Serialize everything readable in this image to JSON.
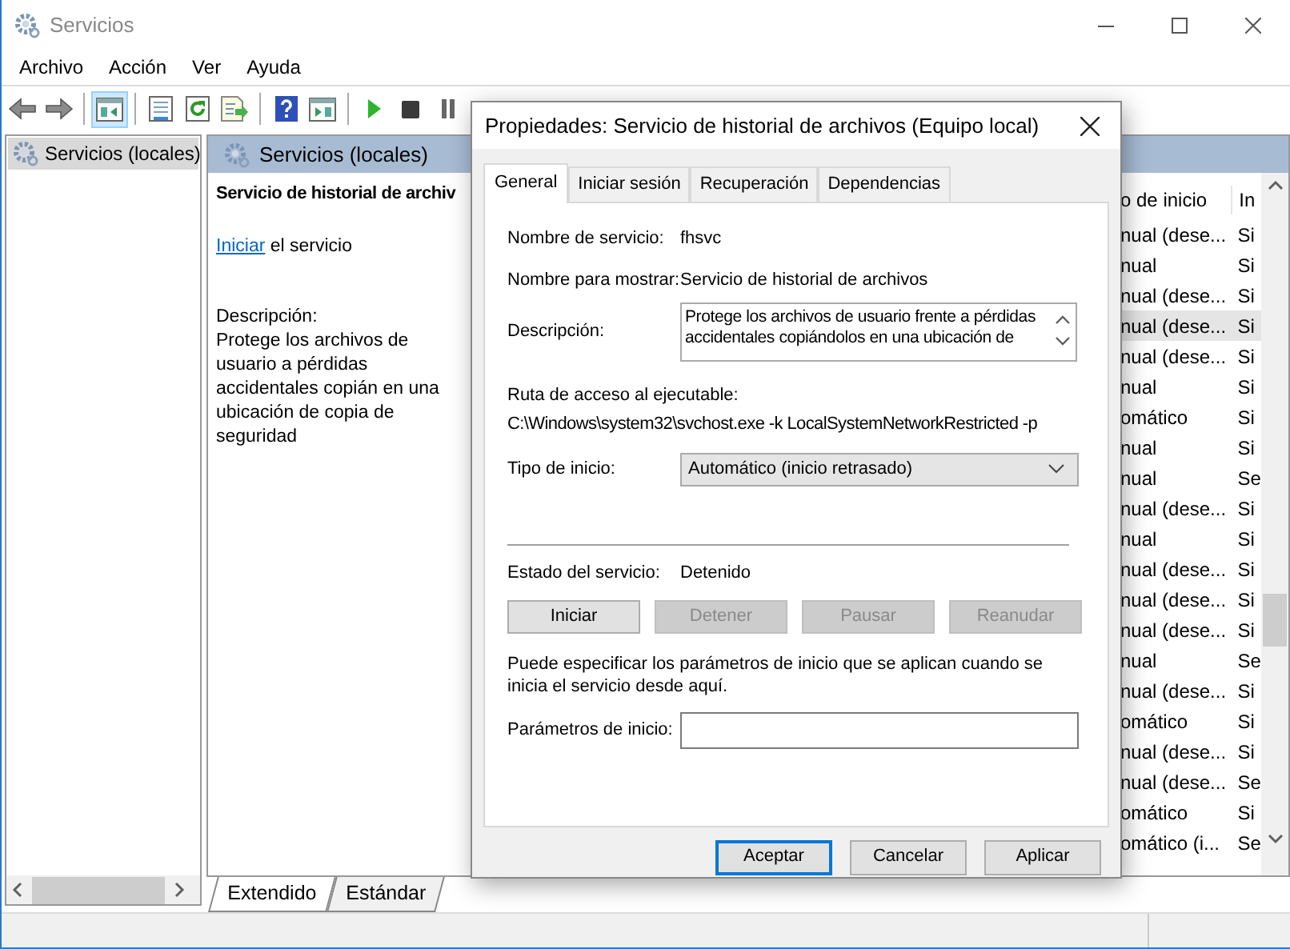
{
  "window": {
    "title": "Servicios"
  },
  "menu": [
    "Archivo",
    "Acción",
    "Ver",
    "Ayuda"
  ],
  "toolbar": [
    {
      "kind": "back",
      "disabled": false,
      "selected": false
    },
    {
      "kind": "forward",
      "disabled": false,
      "selected": false
    },
    {
      "kind": "sep"
    },
    {
      "kind": "tree",
      "disabled": false,
      "selected": true
    },
    {
      "kind": "sep"
    },
    {
      "kind": "properties",
      "disabled": false,
      "selected": false
    },
    {
      "kind": "refresh",
      "disabled": false,
      "selected": false
    },
    {
      "kind": "export",
      "disabled": false,
      "selected": false
    },
    {
      "kind": "sep"
    },
    {
      "kind": "help",
      "disabled": false,
      "selected": false
    },
    {
      "kind": "console",
      "disabled": false,
      "selected": false
    },
    {
      "kind": "sep"
    },
    {
      "kind": "play",
      "disabled": false,
      "selected": false
    },
    {
      "kind": "stop",
      "disabled": false,
      "selected": false
    },
    {
      "kind": "pause",
      "disabled": false,
      "selected": false
    }
  ],
  "tree": {
    "items": [
      {
        "label": "Servicios (locales)",
        "selected": true
      }
    ]
  },
  "panel": {
    "header": "Servicios (locales)",
    "service_title": "Servicio de historial de archiv",
    "action_link": "Iniciar",
    "action_text": "el servicio",
    "description_label": "Descripción:",
    "description": "Protege los archivos de usuario a pérdidas accidentales copián en una ubicación de copia de seguridad"
  },
  "list": {
    "columns": [
      "o de inicio",
      "In"
    ],
    "rows": [
      {
        "cells": [
          "nual (dese...",
          "Si"
        ],
        "highlighted": false
      },
      {
        "cells": [
          "nual",
          "Si"
        ],
        "highlighted": false
      },
      {
        "cells": [
          "nual (dese...",
          "Si"
        ],
        "highlighted": false
      },
      {
        "cells": [
          "nual (dese...",
          "Si"
        ],
        "highlighted": true
      },
      {
        "cells": [
          "nual (dese...",
          "Si"
        ],
        "highlighted": false
      },
      {
        "cells": [
          "nual",
          "Si"
        ],
        "highlighted": false
      },
      {
        "cells": [
          "omático",
          "Si"
        ],
        "highlighted": false
      },
      {
        "cells": [
          "nual",
          "Si"
        ],
        "highlighted": false
      },
      {
        "cells": [
          "nual",
          "Se"
        ],
        "highlighted": false
      },
      {
        "cells": [
          "nual (dese...",
          "Si"
        ],
        "highlighted": false
      },
      {
        "cells": [
          "nual",
          "Si"
        ],
        "highlighted": false
      },
      {
        "cells": [
          "nual (dese...",
          "Si"
        ],
        "highlighted": false
      },
      {
        "cells": [
          "nual (dese...",
          "Si"
        ],
        "highlighted": false
      },
      {
        "cells": [
          "nual (dese...",
          "Si"
        ],
        "highlighted": false
      },
      {
        "cells": [
          "nual",
          "Se"
        ],
        "highlighted": false
      },
      {
        "cells": [
          "nual (dese...",
          "Si"
        ],
        "highlighted": false
      },
      {
        "cells": [
          "omático",
          "Si"
        ],
        "highlighted": false
      },
      {
        "cells": [
          "nual (dese...",
          "Si"
        ],
        "highlighted": false
      },
      {
        "cells": [
          "nual (dese...",
          "Se"
        ],
        "highlighted": false
      },
      {
        "cells": [
          "omático",
          "Si"
        ],
        "highlighted": false
      },
      {
        "cells": [
          "omático (i...",
          "Se"
        ],
        "highlighted": false
      }
    ]
  },
  "view_tabs": [
    {
      "label": "Extendido",
      "selected": true
    },
    {
      "label": "Estándar",
      "selected": false
    }
  ],
  "dialog": {
    "title": "Propiedades: Servicio de historial de archivos (Equipo local)",
    "tabs": [
      {
        "label": "General",
        "selected": true
      },
      {
        "label": "Iniciar sesión",
        "selected": false
      },
      {
        "label": "Recuperación",
        "selected": false
      },
      {
        "label": "Dependencias",
        "selected": false
      }
    ],
    "service_name": {
      "label": "Nombre de servicio:",
      "value": "fhsvc"
    },
    "display_name": {
      "label": "Nombre para mostrar:",
      "value": "Servicio de historial de archivos"
    },
    "description": {
      "label": "Descripción:",
      "lines": [
        "Protege los archivos de usuario frente a pérdidas",
        "accidentales copiándolos en una ubicación de"
      ]
    },
    "path": {
      "label": "Ruta de acceso al ejecutable:",
      "value": "C:\\Windows\\system32\\svchost.exe -k LocalSystemNetworkRestricted -p"
    },
    "startup_type": {
      "label": "Tipo de inicio:",
      "value": "Automático (inicio retrasado)"
    },
    "status": {
      "label": "Estado del servicio:",
      "value": "Detenido"
    },
    "service_buttons": [
      {
        "label": "Iniciar",
        "disabled": false
      },
      {
        "label": "Detener",
        "disabled": true
      },
      {
        "label": "Pausar",
        "disabled": true
      },
      {
        "label": "Reanudar",
        "disabled": true
      }
    ],
    "note": "Puede especificar los parámetros de inicio que se aplican cuando se inicia el servicio desde aquí.",
    "parameters": {
      "label": "Parámetros de inicio:"
    },
    "buttons": [
      {
        "label": "Aceptar",
        "default": true
      },
      {
        "label": "Cancelar",
        "default": false
      },
      {
        "label": "Aplicar",
        "default": false
      }
    ]
  }
}
